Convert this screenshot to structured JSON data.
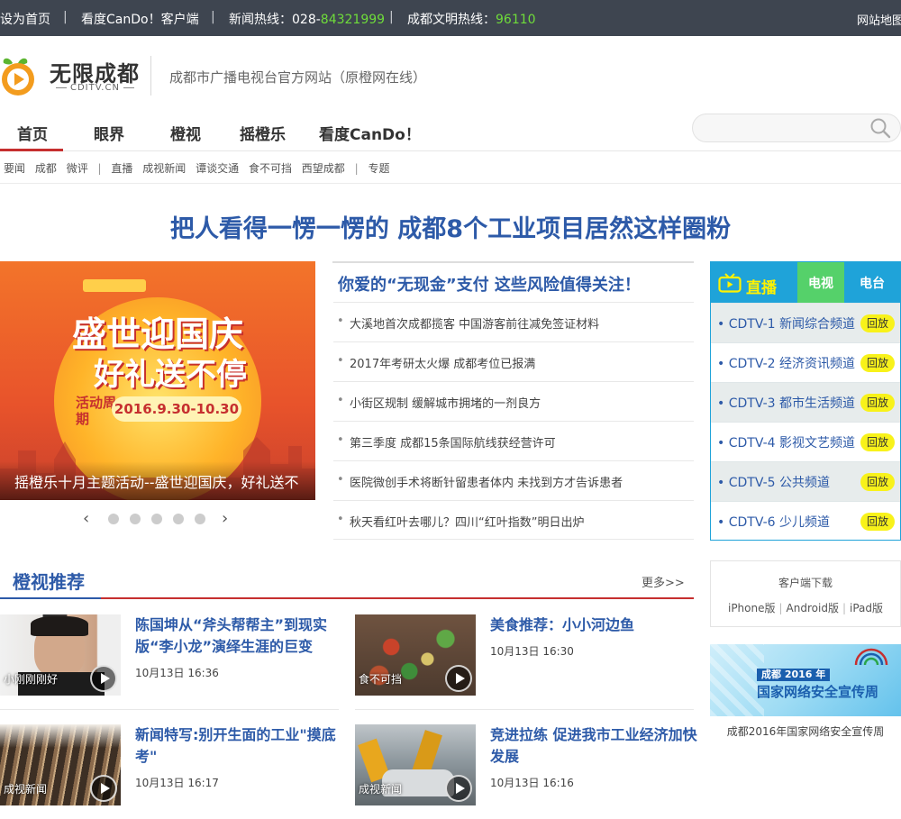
{
  "topbar": {
    "set_home": "设为首页",
    "cando_client": "看度CanDo！客户端",
    "news_hotline_label": "新闻热线：028-",
    "news_hotline_num": "84321999",
    "civil_hotline_label": "成都文明热线：",
    "civil_hotline_num": "96110",
    "sitemap": "网站地图",
    "separator": "|"
  },
  "header": {
    "logo_text": "无限成都",
    "logo_sub": "CDITV.CN",
    "site_desc": "成都市广播电视台官方网站（原橙网在线）"
  },
  "nav": {
    "items": [
      "首页",
      "眼界",
      "橙视",
      "摇橙乐",
      "看度CanDo！"
    ],
    "active": "首页",
    "search_placeholder": ""
  },
  "subnav": {
    "items": [
      "要闻",
      "成都",
      "微评",
      "|",
      "直播",
      "成视新闻",
      "谭谈交通",
      "食不可挡",
      "西望成都",
      "|",
      "专题"
    ]
  },
  "headline": "把人看得一愣一愣的 成都8个工业项目居然这样圈粉",
  "banner": {
    "title_line1": "盛世迎国庆",
    "title_line2": "好礼送不停",
    "activity_label": "活动周期",
    "date_range": "2016.9.30-10.30",
    "caption": "摇橙乐十月主题活动--盛世迎国庆，好礼送不",
    "prev": "‹",
    "next": "›"
  },
  "news": {
    "lead": "你爱的“无现金”支付 这些风险值得关注！",
    "bullet": "•",
    "items": [
      "大溪地首次成都揽客 中国游客前往减免签证材料",
      "2017年考研太火爆 成都考位已报满",
      "小街区规制 缓解城市拥堵的一剂良方",
      "第三季度 成都15条国际航线获经营许可",
      "医院微创手术将断针留患者体内 未找到方才告诉患者",
      "秋天看红叶去哪儿？四川“红叶指数”明日出炉"
    ]
  },
  "live": {
    "title": "直播",
    "tab_tv": "电视",
    "tab_radio": "电台",
    "replay_label": "回放",
    "channels": [
      "• CDTV-1 新闻综合频道",
      "• CDTV-2 经济资讯频道",
      "• CDTV-3 都市生活频道",
      "• CDTV-4 影视文艺频道",
      "• CDTV-5 公共频道",
      "• CDTV-6 少儿频道"
    ]
  },
  "client": {
    "title": "客户端下载",
    "iphone": "iPhone版",
    "android": "Android版",
    "ipad": "iPad版",
    "sep": "|"
  },
  "ad": {
    "year_tag": "成都 2016 年",
    "title": "国家网络安全宣传周",
    "caption": "成都2016年国家网络安全宣传周"
  },
  "section": {
    "title": "橙视推荐",
    "more": "更多>>",
    "cards": [
      {
        "label": "小刚刚刚好",
        "title": "陈国坤从“斧头帮帮主”到现实版“李小龙”演绎生涯的巨变",
        "time": "10月13日 16:36"
      },
      {
        "label": "食不可挡",
        "title": "美食推荐：小小河边鱼",
        "time": "10月13日 16:30"
      },
      {
        "label": "成视新闻",
        "title": "新闻特写:别开生面的工业\"摸底考\"",
        "time": "10月13日 16:17"
      },
      {
        "label": "成视新闻",
        "title": "竞进拉练 促进我市工业经济加快发展",
        "time": "10月13日 16:16"
      }
    ]
  },
  "colors": {
    "topbar_bg": "#3e4550",
    "hotline_green": "#6fdc3a",
    "brand_blue": "#2d5aa8",
    "accent_red": "#c62f2f",
    "live_blue": "#1fa3d9",
    "tv_tab_green": "#55d16a",
    "replay_yellow": "#f8f21a"
  }
}
